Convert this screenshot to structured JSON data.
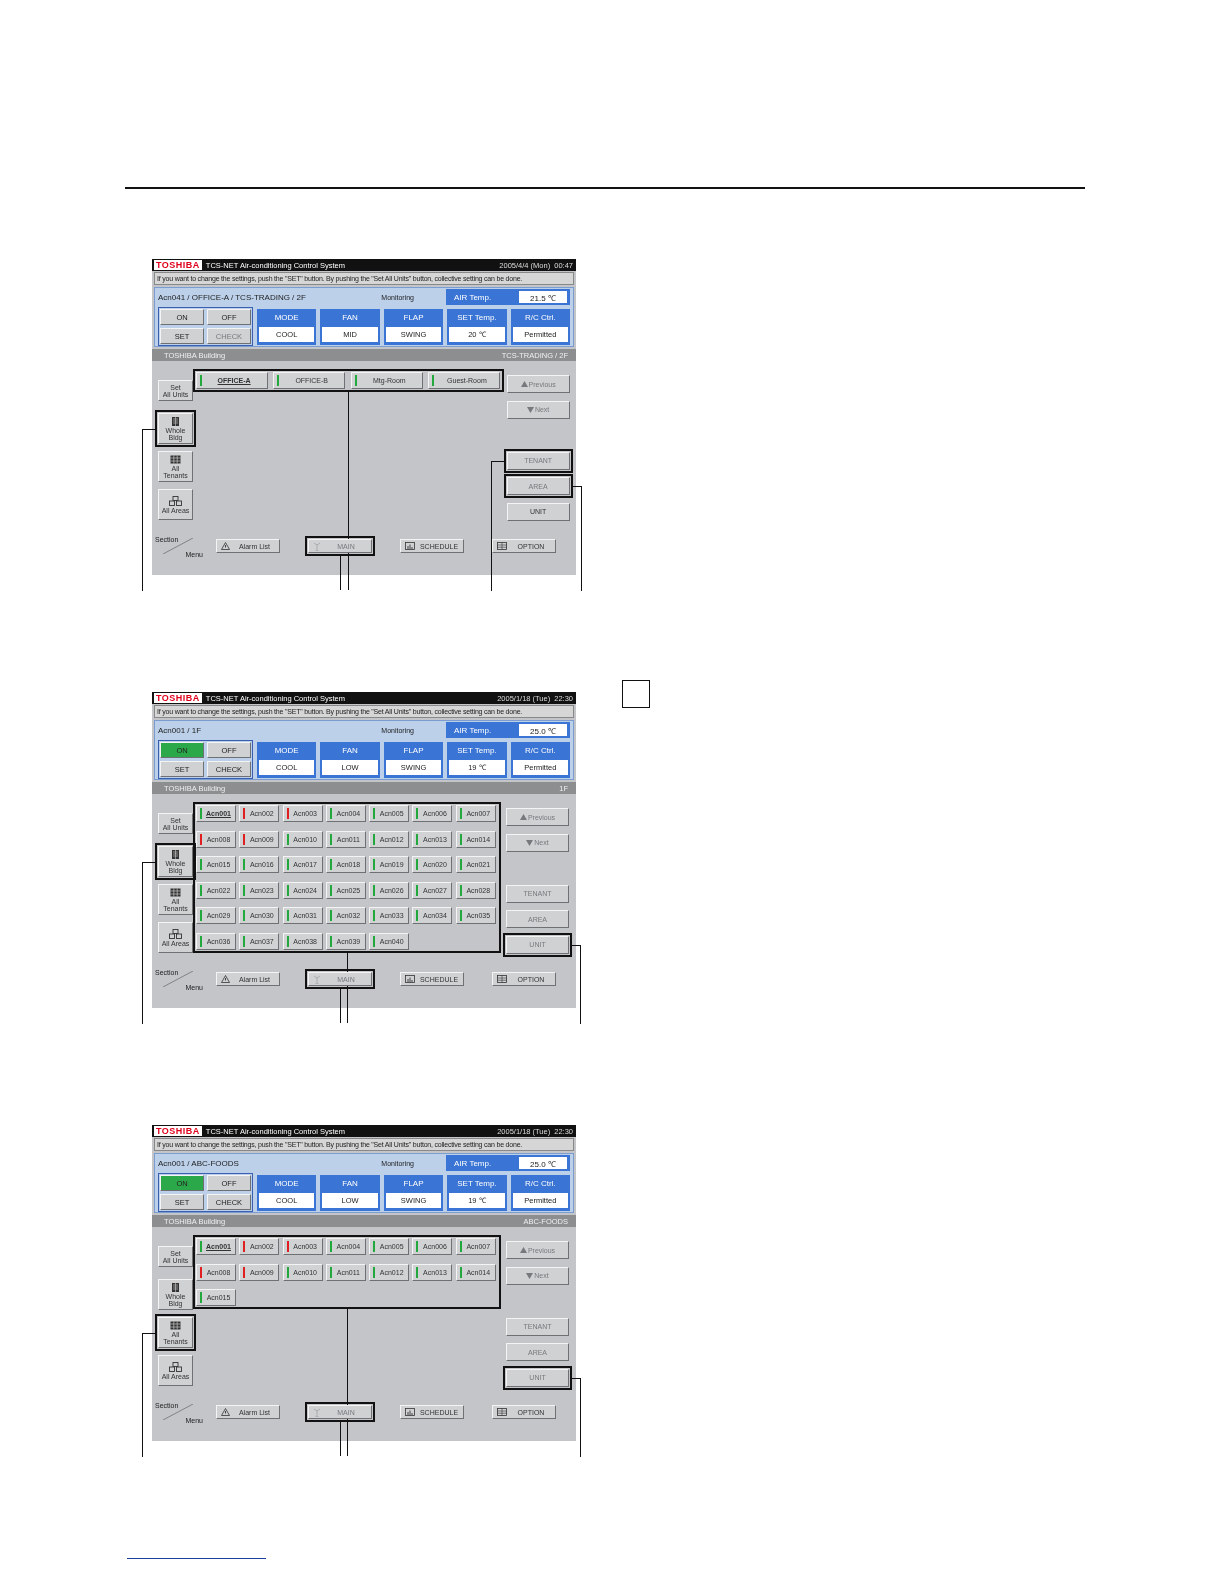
{
  "screens": [
    {
      "header": {
        "logo": "TOSHIBA",
        "title": "TCS-NET Air-conditioning Control System",
        "date": "2005/4/4 (Mon)",
        "time": "00:47"
      },
      "message": "If you want to change the settings, push the \"SET\" button. By pushing the \"Set All Units\" button, collective setting can be done.",
      "unit_name": "Acn041 / OFFICE-A / TCS-TRADING / 2F",
      "status": "Monitoring",
      "air_temp": {
        "label": "AIR Temp.",
        "value": "21.5 ℃"
      },
      "power_buttons": [
        {
          "label": "ON",
          "selected": false,
          "disabled": false
        },
        {
          "label": "OFF",
          "selected": false,
          "disabled": false
        },
        {
          "label": "SET",
          "selected": false,
          "disabled": false
        },
        {
          "label": "CHECK",
          "selected": false,
          "disabled": true
        }
      ],
      "settings": [
        {
          "label": "MODE",
          "value": "COOL"
        },
        {
          "label": "FAN",
          "value": "MID"
        },
        {
          "label": "FLAP",
          "value": "SWING"
        },
        {
          "label": "SET Temp.",
          "value": "20 ℃"
        },
        {
          "label": "R/C Ctrl.",
          "value": "Permitted"
        }
      ],
      "section_bar": {
        "building": "TOSHIBA Building",
        "location": "TCS-TRADING / 2F"
      },
      "side_buttons": [
        {
          "label": "Set\nAll Units",
          "kind": "text",
          "highlighted": false
        },
        {
          "label": "Whole\nBldg",
          "kind": "building",
          "highlighted": true,
          "callout": {
            "kind": "left"
          }
        },
        {
          "label": "All\nTenants",
          "kind": "tenants",
          "highlighted": false
        },
        {
          "label": "All Areas",
          "kind": "areas",
          "highlighted": false
        }
      ],
      "units": {
        "kind": "rooms",
        "highlighted": true,
        "callout": {
          "kind": "down"
        },
        "items": [
          {
            "label": "OFFICE-A",
            "color": "#22a83c",
            "selected": true
          },
          {
            "label": "OFFICE-B",
            "color": "#22a83c",
            "selected": false
          },
          {
            "label": "Mtg-Room",
            "color": "#22a83c",
            "selected": false
          },
          {
            "label": "Guest-Room",
            "color": "#22a83c",
            "selected": false
          }
        ]
      },
      "nav_buttons": [
        {
          "label": "Previous",
          "kind": "up",
          "disabled": true,
          "highlighted": false
        },
        {
          "label": "Next",
          "kind": "down",
          "disabled": true,
          "highlighted": false
        },
        {
          "label": "TENANT",
          "kind": "plain",
          "disabled": true,
          "highlighted": true,
          "callout": {
            "kind": "left"
          }
        },
        {
          "label": "AREA",
          "kind": "plain",
          "disabled": true,
          "highlighted": true,
          "callout": {
            "kind": "right"
          }
        },
        {
          "label": "UNIT",
          "kind": "plain",
          "disabled": false,
          "highlighted": false
        }
      ],
      "menu": {
        "section": "Section",
        "menu": "Menu",
        "buttons": [
          {
            "label": "Alarm List",
            "kind": "alarm",
            "disabled": false,
            "highlighted": false
          },
          {
            "label": "MAIN",
            "kind": "main",
            "disabled": true,
            "highlighted": true,
            "callout": {
              "kind": "down"
            }
          },
          {
            "label": "SCHEDULE",
            "kind": "schedule",
            "disabled": false,
            "highlighted": false
          },
          {
            "label": "OPTION",
            "kind": "option",
            "disabled": false,
            "highlighted": false
          }
        ]
      }
    },
    {
      "marker_box": true,
      "header": {
        "logo": "TOSHIBA",
        "title": "TCS-NET Air-conditioning Control System",
        "date": "2005/1/18 (Tue)",
        "time": "22:30"
      },
      "message": "If you want to change the settings, push the \"SET\" button. By pushing the \"Set All Units\" button, collective setting can be done.",
      "unit_name": "Acn001 / 1F",
      "status": "Monitoring",
      "air_temp": {
        "label": "AIR Temp.",
        "value": "25.0 ℃"
      },
      "power_buttons": [
        {
          "label": "ON",
          "selected": true,
          "disabled": false
        },
        {
          "label": "OFF",
          "selected": false,
          "disabled": false
        },
        {
          "label": "SET",
          "selected": false,
          "disabled": false
        },
        {
          "label": "CHECK",
          "selected": false,
          "disabled": false
        }
      ],
      "settings": [
        {
          "label": "MODE",
          "value": "COOL"
        },
        {
          "label": "FAN",
          "value": "LOW"
        },
        {
          "label": "FLAP",
          "value": "SWING"
        },
        {
          "label": "SET Temp.",
          "value": "19 ℃"
        },
        {
          "label": "R/C Ctrl.",
          "value": "Permitted"
        }
      ],
      "section_bar": {
        "building": "TOSHIBA Building",
        "location": "1F"
      },
      "side_buttons": [
        {
          "label": "Set\nAll Units",
          "kind": "text",
          "highlighted": false
        },
        {
          "label": "Whole\nBldg",
          "kind": "building",
          "highlighted": true,
          "callout": {
            "kind": "left"
          }
        },
        {
          "label": "All\nTenants",
          "kind": "tenants",
          "highlighted": false
        },
        {
          "label": "All Areas",
          "kind": "areas",
          "highlighted": false
        }
      ],
      "units": {
        "kind": "units",
        "highlighted": true,
        "callout": {
          "kind": "down"
        },
        "items": [
          {
            "label": "Acn001",
            "color": "#22a83c",
            "selected": true
          },
          {
            "label": "Acn002",
            "color": "#e02020",
            "selected": false
          },
          {
            "label": "Acn003",
            "color": "#e02020",
            "selected": false
          },
          {
            "label": "Acn004",
            "color": "#22a83c",
            "selected": false
          },
          {
            "label": "Acn005",
            "color": "#22a83c",
            "selected": false
          },
          {
            "label": "Acn006",
            "color": "#22a83c",
            "selected": false
          },
          {
            "label": "Acn007",
            "color": "#22a83c",
            "selected": false
          },
          {
            "label": "Acn008",
            "color": "#e02020",
            "selected": false
          },
          {
            "label": "Acn009",
            "color": "#e02020",
            "selected": false
          },
          {
            "label": "Acn010",
            "color": "#22a83c",
            "selected": false
          },
          {
            "label": "Acn011",
            "color": "#22a83c",
            "selected": false
          },
          {
            "label": "Acn012",
            "color": "#22a83c",
            "selected": false
          },
          {
            "label": "Acn013",
            "color": "#22a83c",
            "selected": false
          },
          {
            "label": "Acn014",
            "color": "#22a83c",
            "selected": false
          },
          {
            "label": "Acn015",
            "color": "#22a83c",
            "selected": false
          },
          {
            "label": "Acn016",
            "color": "#22a83c",
            "selected": false
          },
          {
            "label": "Acn017",
            "color": "#22a83c",
            "selected": false
          },
          {
            "label": "Acn018",
            "color": "#22a83c",
            "selected": false
          },
          {
            "label": "Acn019",
            "color": "#22a83c",
            "selected": false
          },
          {
            "label": "Acn020",
            "color": "#22a83c",
            "selected": false
          },
          {
            "label": "Acn021",
            "color": "#22a83c",
            "selected": false
          },
          {
            "label": "Acn022",
            "color": "#22a83c",
            "selected": false
          },
          {
            "label": "Acn023",
            "color": "#22a83c",
            "selected": false
          },
          {
            "label": "Acn024",
            "color": "#22a83c",
            "selected": false
          },
          {
            "label": "Acn025",
            "color": "#22a83c",
            "selected": false
          },
          {
            "label": "Acn026",
            "color": "#22a83c",
            "selected": false
          },
          {
            "label": "Acn027",
            "color": "#22a83c",
            "selected": false
          },
          {
            "label": "Acn028",
            "color": "#22a83c",
            "selected": false
          },
          {
            "label": "Acn029",
            "color": "#22a83c",
            "selected": false
          },
          {
            "label": "Acn030",
            "color": "#22a83c",
            "selected": false
          },
          {
            "label": "Acn031",
            "color": "#22a83c",
            "selected": false
          },
          {
            "label": "Acn032",
            "color": "#22a83c",
            "selected": false
          },
          {
            "label": "Acn033",
            "color": "#22a83c",
            "selected": false
          },
          {
            "label": "Acn034",
            "color": "#22a83c",
            "selected": false
          },
          {
            "label": "Acn035",
            "color": "#22a83c",
            "selected": false
          },
          {
            "label": "Acn036",
            "color": "#22a83c",
            "selected": false
          },
          {
            "label": "Acn037",
            "color": "#22a83c",
            "selected": false
          },
          {
            "label": "Acn038",
            "color": "#22a83c",
            "selected": false
          },
          {
            "label": "Acn039",
            "color": "#22a83c",
            "selected": false
          },
          {
            "label": "Acn040",
            "color": "#22a83c",
            "selected": false
          }
        ]
      },
      "nav_buttons": [
        {
          "label": "Previous",
          "kind": "up",
          "disabled": true,
          "highlighted": false
        },
        {
          "label": "Next",
          "kind": "down",
          "disabled": true,
          "highlighted": false
        },
        {
          "label": "TENANT",
          "kind": "plain",
          "disabled": true,
          "highlighted": false
        },
        {
          "label": "AREA",
          "kind": "plain",
          "disabled": true,
          "highlighted": false
        },
        {
          "label": "UNIT",
          "kind": "plain",
          "disabled": true,
          "highlighted": true,
          "callout": {
            "kind": "right"
          }
        }
      ],
      "menu": {
        "section": "Section",
        "menu": "Menu",
        "buttons": [
          {
            "label": "Alarm List",
            "kind": "alarm",
            "disabled": false,
            "highlighted": false
          },
          {
            "label": "MAIN",
            "kind": "main",
            "disabled": true,
            "highlighted": true,
            "callout": {
              "kind": "down"
            }
          },
          {
            "label": "SCHEDULE",
            "kind": "schedule",
            "disabled": false,
            "highlighted": false
          },
          {
            "label": "OPTION",
            "kind": "option",
            "disabled": false,
            "highlighted": false
          }
        ]
      }
    },
    {
      "header": {
        "logo": "TOSHIBA",
        "title": "TCS-NET Air-conditioning Control System",
        "date": "2005/1/18 (Tue)",
        "time": "22:30"
      },
      "message": "If you want to change the settings, push the \"SET\" button. By pushing the \"Set All Units\" button, collective setting can be done.",
      "unit_name": "Acn001 / ABC-FOODS",
      "status": "Monitoring",
      "air_temp": {
        "label": "AIR Temp.",
        "value": "25.0 ℃"
      },
      "power_buttons": [
        {
          "label": "ON",
          "selected": true,
          "disabled": false
        },
        {
          "label": "OFF",
          "selected": false,
          "disabled": false
        },
        {
          "label": "SET",
          "selected": false,
          "disabled": false
        },
        {
          "label": "CHECK",
          "selected": false,
          "disabled": false
        }
      ],
      "settings": [
        {
          "label": "MODE",
          "value": "COOL"
        },
        {
          "label": "FAN",
          "value": "LOW"
        },
        {
          "label": "FLAP",
          "value": "SWING"
        },
        {
          "label": "SET Temp.",
          "value": "19 ℃"
        },
        {
          "label": "R/C Ctrl.",
          "value": "Permitted"
        }
      ],
      "section_bar": {
        "building": "TOSHIBA Building",
        "location": "ABC-FOODS"
      },
      "side_buttons": [
        {
          "label": "Set\nAll Units",
          "kind": "text",
          "highlighted": false
        },
        {
          "label": "Whole\nBldg",
          "kind": "building",
          "highlighted": false
        },
        {
          "label": "All\nTenants",
          "kind": "tenants",
          "highlighted": true,
          "callout": {
            "kind": "left"
          }
        },
        {
          "label": "All Areas",
          "kind": "areas",
          "highlighted": false
        }
      ],
      "units": {
        "kind": "units",
        "highlighted": true,
        "callout": {
          "kind": "down"
        },
        "items": [
          {
            "label": "Acn001",
            "color": "#22a83c",
            "selected": true
          },
          {
            "label": "Acn002",
            "color": "#e02020",
            "selected": false
          },
          {
            "label": "Acn003",
            "color": "#e02020",
            "selected": false
          },
          {
            "label": "Acn004",
            "color": "#22a83c",
            "selected": false
          },
          {
            "label": "Acn005",
            "color": "#22a83c",
            "selected": false
          },
          {
            "label": "Acn006",
            "color": "#22a83c",
            "selected": false
          },
          {
            "label": "Acn007",
            "color": "#22a83c",
            "selected": false
          },
          {
            "label": "Acn008",
            "color": "#e02020",
            "selected": false
          },
          {
            "label": "Acn009",
            "color": "#e02020",
            "selected": false
          },
          {
            "label": "Acn010",
            "color": "#22a83c",
            "selected": false
          },
          {
            "label": "Acn011",
            "color": "#22a83c",
            "selected": false
          },
          {
            "label": "Acn012",
            "color": "#22a83c",
            "selected": false
          },
          {
            "label": "Acn013",
            "color": "#22a83c",
            "selected": false
          },
          {
            "label": "Acn014",
            "color": "#22a83c",
            "selected": false
          },
          {
            "label": "Acn015",
            "color": "#22a83c",
            "selected": false
          }
        ]
      },
      "nav_buttons": [
        {
          "label": "Previous",
          "kind": "up",
          "disabled": true,
          "highlighted": false
        },
        {
          "label": "Next",
          "kind": "down",
          "disabled": true,
          "highlighted": false
        },
        {
          "label": "TENANT",
          "kind": "plain",
          "disabled": true,
          "highlighted": false
        },
        {
          "label": "AREA",
          "kind": "plain",
          "disabled": true,
          "highlighted": false
        },
        {
          "label": "UNIT",
          "kind": "plain",
          "disabled": true,
          "highlighted": true,
          "callout": {
            "kind": "right"
          }
        }
      ],
      "menu": {
        "section": "Section",
        "menu": "Menu",
        "buttons": [
          {
            "label": "Alarm List",
            "kind": "alarm",
            "disabled": false,
            "highlighted": false
          },
          {
            "label": "MAIN",
            "kind": "main",
            "disabled": true,
            "highlighted": true,
            "callout": {
              "kind": "down"
            }
          },
          {
            "label": "SCHEDULE",
            "kind": "schedule",
            "disabled": false,
            "highlighted": false
          },
          {
            "label": "OPTION",
            "kind": "option",
            "disabled": false,
            "highlighted": false
          }
        ]
      }
    }
  ]
}
